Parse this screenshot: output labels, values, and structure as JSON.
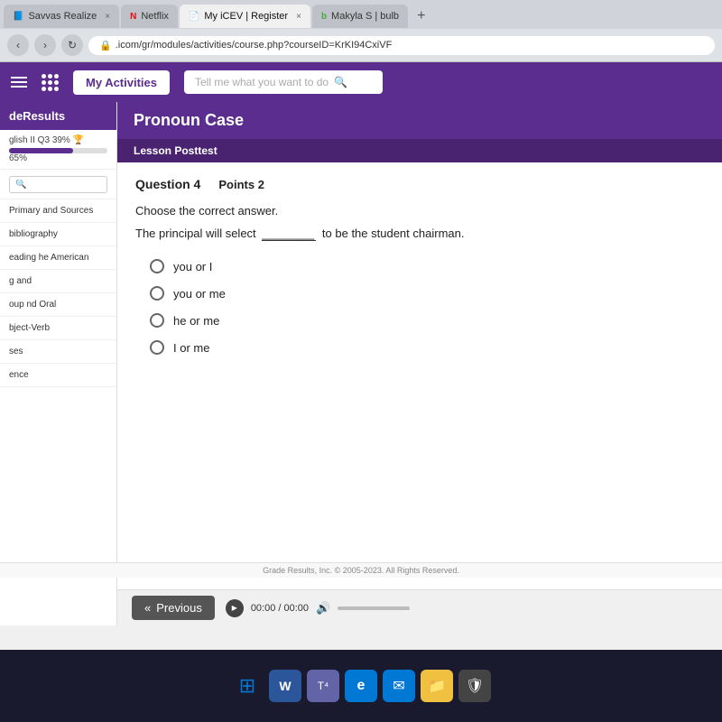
{
  "browser": {
    "tabs": [
      {
        "id": "tab-savvas",
        "label": "Savvas Realize",
        "icon": "📘",
        "active": false
      },
      {
        "id": "tab-netflix",
        "label": "Netflix",
        "icon": "N",
        "active": false
      },
      {
        "id": "tab-icev",
        "label": "My iCEV | Register",
        "icon": "📄",
        "active": true
      },
      {
        "id": "tab-bulb",
        "label": "Makyla S | bulb",
        "icon": "b",
        "active": false
      }
    ],
    "url": ".icom/gr/modules/activities/course.php?courseID=KrKI94CxiVF",
    "close_label": "×",
    "new_tab_label": "+"
  },
  "nav": {
    "my_activities_label": "My Activities",
    "search_placeholder": "Tell me what you want to do",
    "search_icon": "🔍"
  },
  "sidebar": {
    "brand": "deResults",
    "course_label": "glish II Q3",
    "progress_pct": 65,
    "progress_text": "65%",
    "trophy_label": "39% 🏆",
    "items": [
      {
        "label": "Primary and Sources"
      },
      {
        "label": "bibliography"
      },
      {
        "label": "eading he American"
      },
      {
        "label": "g and"
      },
      {
        "label": "oup nd Oral"
      },
      {
        "label": "bject-Verb"
      },
      {
        "label": "ses"
      },
      {
        "label": "ence"
      }
    ]
  },
  "content": {
    "title": "Pronoun Case",
    "section": "Lesson Posttest",
    "question_number": "Question 4",
    "points_label": "Points 2",
    "instruction": "Choose the correct answer.",
    "question_text": "The principal will select",
    "question_blank": "________",
    "question_suffix": "to be the student chairman.",
    "options": [
      {
        "id": "opt1",
        "label": "you or I"
      },
      {
        "id": "opt2",
        "label": "you or me"
      },
      {
        "id": "opt3",
        "label": "he or me"
      },
      {
        "id": "opt4",
        "label": "I or me"
      }
    ]
  },
  "bottom_bar": {
    "previous_label": "Previous",
    "chevron_left": "«",
    "play_label": "▶",
    "time_label": "00:00 / 00:00",
    "volume_label": "🔊"
  },
  "footer": {
    "copyright": "Grade Results, Inc. © 2005-2023. All Rights Reserved."
  },
  "taskbar": {
    "items": [
      {
        "id": "windows",
        "label": "⊞",
        "type": "windows"
      },
      {
        "id": "word",
        "label": "W",
        "type": "word"
      },
      {
        "id": "teams",
        "label": "T",
        "type": "teams"
      },
      {
        "id": "edge",
        "label": "e",
        "type": "edge"
      },
      {
        "id": "mail",
        "label": "✉",
        "type": "mail"
      },
      {
        "id": "files",
        "label": "📁",
        "type": "files"
      },
      {
        "id": "security",
        "label": "🔒",
        "type": "security"
      }
    ]
  }
}
